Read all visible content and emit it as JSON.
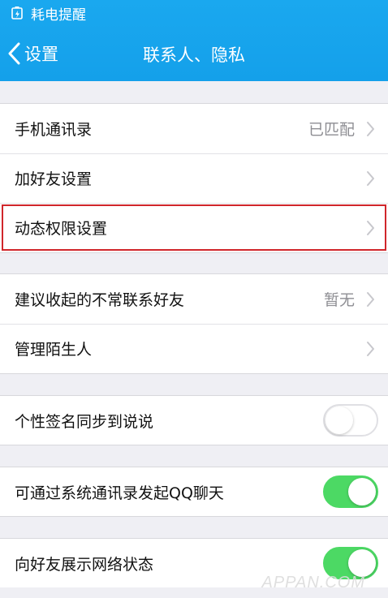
{
  "statusbar": {
    "icon": "battery-warning-icon",
    "text": "耗电提醒"
  },
  "navbar": {
    "back_label": "设置",
    "title": "联系人、隐私"
  },
  "group1": {
    "items": [
      {
        "label": "手机通讯录",
        "value": "已匹配"
      },
      {
        "label": "加好友设置",
        "value": ""
      },
      {
        "label": "动态权限设置",
        "value": ""
      }
    ]
  },
  "group2": {
    "items": [
      {
        "label": "建议收起的不常联系好友",
        "value": "暂无"
      },
      {
        "label": "管理陌生人",
        "value": ""
      }
    ]
  },
  "toggles": [
    {
      "label": "个性签名同步到说说",
      "on": false
    },
    {
      "label": "可通过系统通讯录发起QQ聊天",
      "on": true
    },
    {
      "label": "向好友展示网络状态",
      "on": true
    }
  ],
  "watermark": "APPAN.COM",
  "colors": {
    "header": "#1aa8ef",
    "switch_on": "#4cd964",
    "highlight_border": "#d0262b",
    "background": "#efeff4"
  }
}
